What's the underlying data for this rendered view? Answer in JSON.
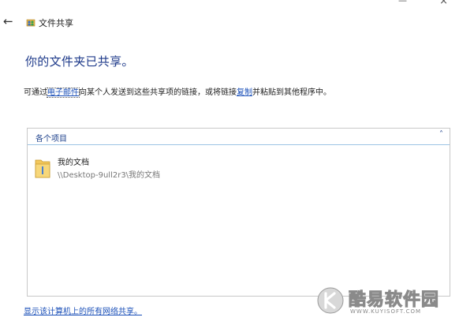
{
  "window": {
    "title": "文件共享",
    "back_glyph": "←",
    "minimize_glyph": "—",
    "close_glyph": "×"
  },
  "heading": "你的文件夹已共享。",
  "description": {
    "part1": "可通过",
    "email_link": "电子邮件",
    "part2": "向某个人发送到这些共享项的链接，或将链接",
    "copy_link": "复制",
    "part3": "并粘贴到其他程序中。"
  },
  "panel": {
    "header": "各个项目",
    "collapse_glyph": "˄",
    "items": [
      {
        "name": "我的文档",
        "path": "\\\\Desktop-9ull2r3\\我的文档"
      }
    ]
  },
  "footer_link": "显示该计算机上的所有网络共享。",
  "watermark": {
    "brand": "酷易软件园",
    "url": "WWW.KUYISOFT.COM"
  }
}
